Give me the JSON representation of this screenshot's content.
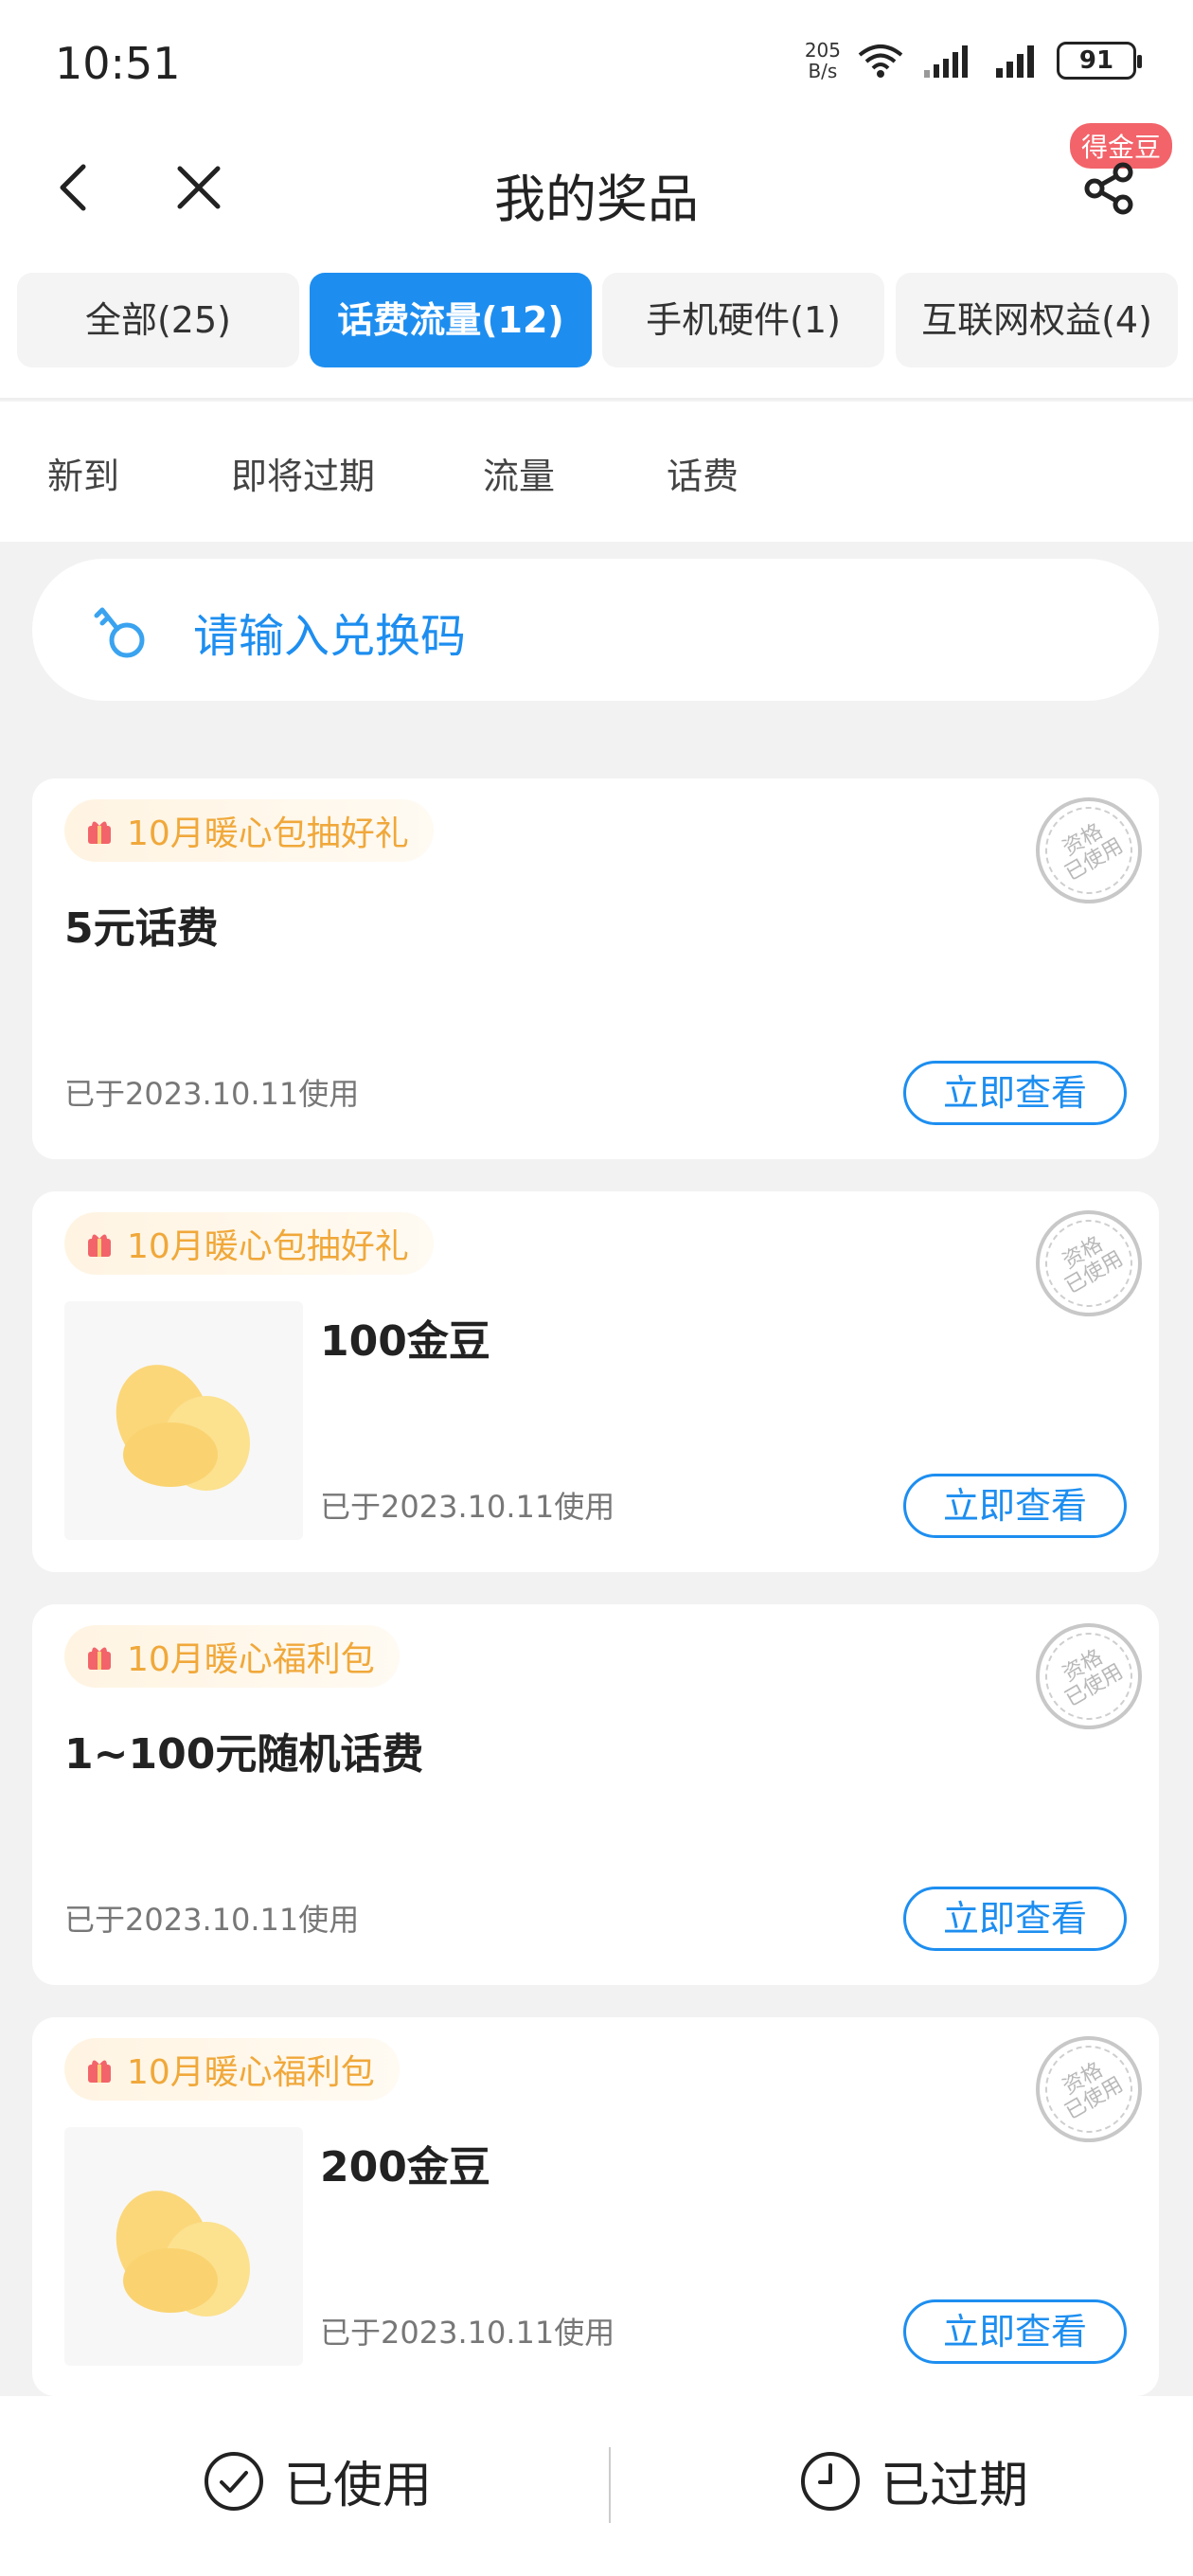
{
  "status_bar": {
    "time": "10:51",
    "net_speed_value": "205",
    "net_speed_unit": "B/s",
    "battery": "91"
  },
  "header": {
    "title": "我的奖品",
    "badge": "得金豆"
  },
  "tabs": [
    {
      "label": "全部(25)",
      "active": false
    },
    {
      "label": "话费流量(12)",
      "active": true
    },
    {
      "label": "手机硬件(1)",
      "active": false
    },
    {
      "label": "互联网权益(4)",
      "active": false
    }
  ],
  "subtabs": [
    "新到",
    "即将过期",
    "流量",
    "话费"
  ],
  "redeem": {
    "placeholder": "请输入兑换码"
  },
  "stamp": {
    "line1": "资格",
    "line2": "已使用"
  },
  "cards": [
    {
      "tag": "10月暖心包抽好礼",
      "title": "5元话费",
      "used": "已于2023.10.11使用",
      "button": "立即查看"
    },
    {
      "tag": "10月暖心包抽好礼",
      "title": "100金豆",
      "used": "已于2023.10.11使用",
      "button": "立即查看"
    },
    {
      "tag": "10月暖心福利包",
      "title": "1~100元随机话费",
      "used": "已于2023.10.11使用",
      "button": "立即查看"
    },
    {
      "tag": "10月暖心福利包",
      "title": "200金豆",
      "used": "已于2023.10.11使用",
      "button": "立即查看"
    }
  ],
  "bottom_bar": {
    "used_label": "已使用",
    "expired_label": "已过期"
  },
  "colors": {
    "accent": "#1d8ef0",
    "tag_text": "#f0a83a",
    "badge": "#f2646a"
  }
}
